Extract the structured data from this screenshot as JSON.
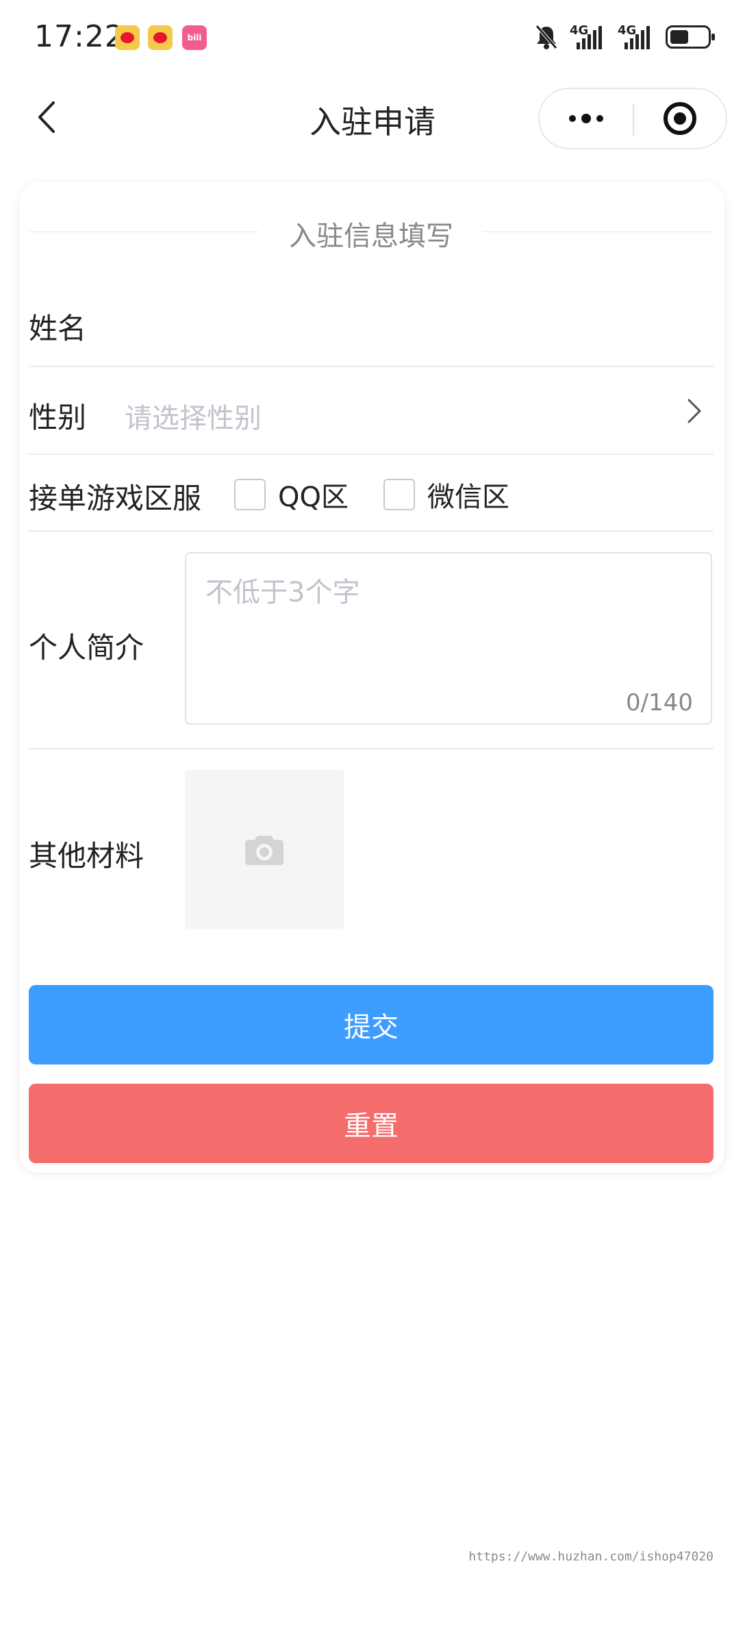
{
  "status_bar": {
    "time": "17:22",
    "apps": [
      "weibo-icon",
      "weibo-icon",
      "bilibili-icon"
    ],
    "bilibili_label": "bili",
    "signal_1": "4G",
    "signal_2": "4G"
  },
  "nav": {
    "title": "入驻申请"
  },
  "form": {
    "section_title": "入驻信息填写",
    "name_label": "姓名",
    "gender_label": "性别",
    "gender_placeholder": "请选择性别",
    "game_label": "接单游戏区服",
    "game_options": [
      "QQ区",
      "微信区"
    ],
    "intro_label": "个人简介",
    "intro_placeholder": "不低于3个字",
    "intro_counter": "0/140",
    "material_label": "其他材料"
  },
  "buttons": {
    "submit": "提交",
    "reset": "重置"
  },
  "colors": {
    "submit": "#3c9cff",
    "reset": "#f56c6c",
    "placeholder": "#c0c4cc"
  },
  "watermark": "https://www.huzhan.com/ishop47020"
}
